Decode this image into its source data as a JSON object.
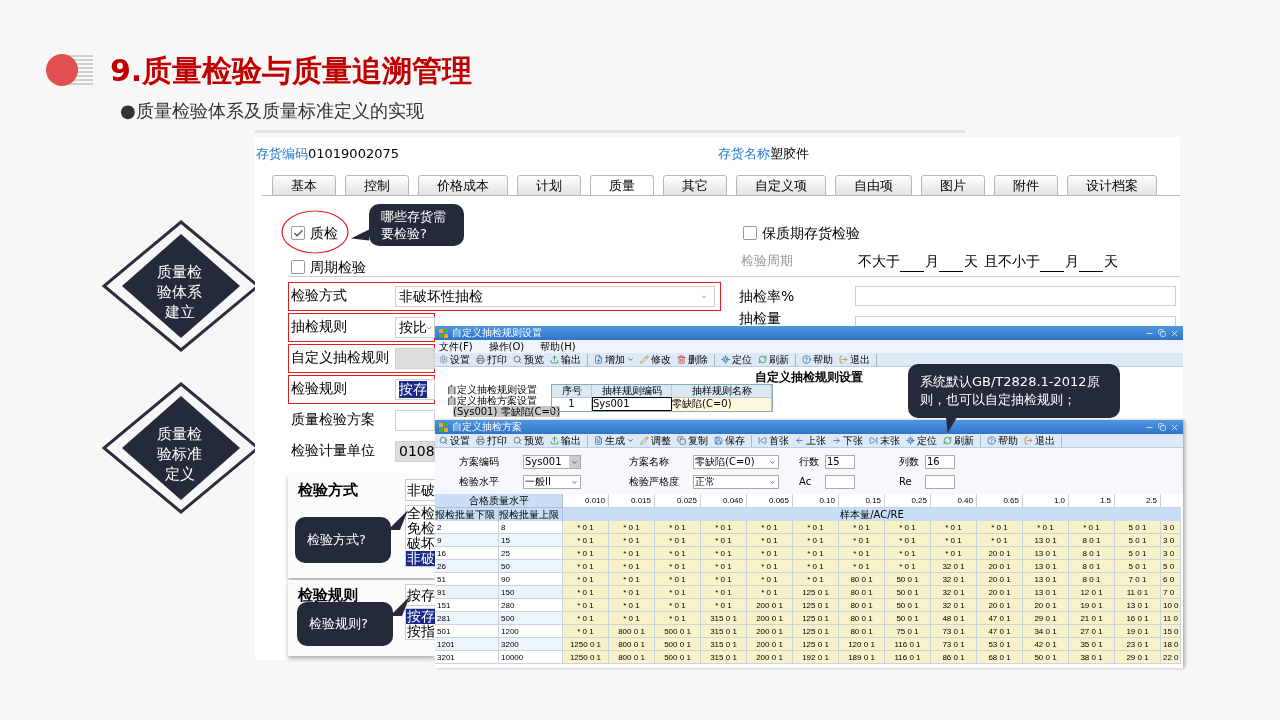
{
  "slide": {
    "title": "9.质量检验与质量追溯管理",
    "subtitle": "●质量检验体系及质量标准定义的实现"
  },
  "stages": [
    {
      "label": "质量检验体系建立"
    },
    {
      "label": "质量检验标准定义"
    }
  ],
  "inventory_form": {
    "code_label": "存货编码",
    "code": "01019002075",
    "name_label": "存货名称",
    "name": "塑胶件",
    "tabs": [
      {
        "label": "基本",
        "selected": false
      },
      {
        "label": "控制",
        "selected": false
      },
      {
        "label": "价格成本",
        "selected": false
      },
      {
        "label": "计划",
        "selected": false
      },
      {
        "label": "质量",
        "selected": true
      },
      {
        "label": "其它",
        "selected": false
      },
      {
        "label": "自定义项",
        "selected": false
      },
      {
        "label": "自由项",
        "selected": false
      },
      {
        "label": "图片",
        "selected": false
      },
      {
        "label": "附件",
        "selected": false
      },
      {
        "label": "设计档案",
        "selected": false
      }
    ],
    "checks": [
      {
        "label": "质检",
        "checked": true,
        "circled": true
      },
      {
        "label": "周期检验",
        "checked": false,
        "circled": false
      },
      {
        "label": "保质期存货检验",
        "checked": false,
        "circled": false
      }
    ],
    "period_label": "检验周期",
    "period_parts": [
      {
        "text": "不大于",
        "blank_before": false
      },
      {
        "text": "月",
        "blank_before": true
      },
      {
        "text": "天",
        "blank_before": true
      },
      {
        "text": "且不小于",
        "blank_before": false
      },
      {
        "text": "月",
        "blank_before": true
      },
      {
        "text": "天",
        "blank_before": true
      }
    ],
    "fields": [
      {
        "label": "检验方式",
        "value": "非破坏性抽检",
        "kind": "dropdown",
        "highlighted": true,
        "disabled": false
      },
      {
        "label": "抽检规则",
        "value": "按比",
        "kind": "dropdown",
        "highlighted": true,
        "disabled": false
      },
      {
        "label": "自定义抽检规则",
        "kind": "text",
        "highlighted": true,
        "disabled": true
      },
      {
        "label": "检验规则",
        "value": "按存",
        "kind": "text",
        "highlighted": true,
        "disabled": false,
        "value_selected": true
      },
      {
        "label": "质量检验方案",
        "kind": "text",
        "highlighted": false,
        "disabled": false
      },
      {
        "label": "检验计量单位",
        "value": "0108",
        "kind": "text",
        "highlighted": false,
        "disabled": true
      }
    ],
    "right_fields": [
      {
        "label": "抽检率%"
      },
      {
        "label": "抽检量"
      }
    ],
    "callout": "哪些存货需要检验?"
  },
  "popups": [
    {
      "label": "检验方式",
      "value": "非破",
      "options": [
        {
          "label": "全检",
          "selected": false
        },
        {
          "label": "免检",
          "selected": false
        },
        {
          "label": "破坏",
          "selected": false
        },
        {
          "label": "非破",
          "selected": true
        }
      ],
      "callout": "检验方式?"
    },
    {
      "label": "检验规则",
      "value": "按存",
      "options": [
        {
          "label": "按存",
          "selected": true
        },
        {
          "label": "按指",
          "selected": false
        }
      ],
      "callout": "检验规则?"
    }
  ],
  "rule_window": {
    "title": "自定义抽检规则设置",
    "menus": [
      "文件(F)",
      "操作(O)",
      "帮助(H)"
    ],
    "toolbar": [
      [
        {
          "label": "设置",
          "kind": "button"
        },
        {
          "label": "打印",
          "kind": "button"
        },
        {
          "label": "预览",
          "kind": "button"
        },
        {
          "label": "输出",
          "kind": "button"
        }
      ],
      [
        {
          "label": "增加",
          "kind": "dropdown"
        },
        {
          "label": "修改",
          "kind": "button"
        },
        {
          "label": "删除",
          "kind": "button"
        }
      ],
      [
        {
          "label": "定位",
          "kind": "button"
        },
        {
          "label": "刷新",
          "kind": "button"
        }
      ],
      [
        {
          "label": "帮助",
          "kind": "button"
        },
        {
          "label": "退出",
          "kind": "button"
        }
      ]
    ],
    "heading": "自定义抽检规则设置",
    "tree": [
      {
        "label": "自定义抽检规则设置",
        "selected": false
      },
      {
        "label": "自定义抽检方案设置",
        "selected": false,
        "children": [
          {
            "label": "(Sys001) 零缺陷(C=0)",
            "selected": true
          }
        ]
      }
    ],
    "table": {
      "columns": [
        "序号",
        "抽样规则编码",
        "抽样规则名称"
      ],
      "rows": [
        [
          "1",
          "Sys001",
          "零缺陷(C=0)"
        ]
      ]
    },
    "callout": "系统默认GB/T2828.1-2012原则，也可以自定抽检规则；"
  },
  "scheme_window": {
    "title": "自定义抽检方案",
    "toolbar": [
      [
        {
          "label": "设置",
          "kind": "button"
        },
        {
          "label": "打印",
          "kind": "button"
        },
        {
          "label": "预览",
          "kind": "button"
        },
        {
          "label": "输出",
          "kind": "button"
        }
      ],
      [
        {
          "label": "生成",
          "kind": "dropdown"
        },
        {
          "label": "调整",
          "kind": "button"
        },
        {
          "label": "复制",
          "kind": "button"
        },
        {
          "label": "保存",
          "kind": "button"
        }
      ],
      [
        {
          "label": "首张",
          "kind": "button"
        },
        {
          "label": "上张",
          "kind": "button"
        },
        {
          "label": "下张",
          "kind": "button"
        },
        {
          "label": "末张",
          "kind": "button"
        },
        {
          "label": "定位",
          "kind": "button"
        },
        {
          "label": "刷新",
          "kind": "button"
        }
      ],
      [
        {
          "label": "帮助",
          "kind": "button"
        },
        {
          "label": "退出",
          "kind": "button"
        }
      ]
    ],
    "form": [
      [
        {
          "label": "方案编码",
          "value": "Sys001",
          "kind": "combo"
        },
        {
          "label": "方案名称",
          "value": "零缺陷(C=0)",
          "kind": "dropdown"
        },
        {
          "label": "行数",
          "value": "15",
          "kind": "text"
        },
        {
          "label": "列数",
          "value": "16",
          "kind": "text"
        }
      ],
      [
        {
          "label": "检验水平",
          "value": "一般II",
          "kind": "dropdown"
        },
        {
          "label": "检验严格度",
          "value": "正常",
          "kind": "dropdown"
        },
        {
          "label": "Ac",
          "kind": "text"
        },
        {
          "label": "Re",
          "kind": "text"
        }
      ]
    ],
    "table": {
      "header_label": "合格质量水平",
      "aql": [
        "0.010",
        "0.015",
        "0.025",
        "0.040",
        "0.065",
        "0.10",
        "0.15",
        "0.25",
        "0.40",
        "0.65",
        "1.0",
        "1.5",
        "2.5"
      ],
      "lower_label": "报检批量下限",
      "upper_label": "报检批量上限",
      "span_label": "样本量/AC/RE",
      "rows": [
        {
          "lower": "2",
          "upper": "8",
          "cells": [
            "* 0 1",
            "* 0 1",
            "* 0 1",
            "* 0 1",
            "* 0 1",
            "* 0 1",
            "* 0 1",
            "* 0 1",
            "* 0 1",
            "* 0 1",
            "* 0 1",
            "* 0 1",
            "5 0 1",
            "3 0"
          ]
        },
        {
          "lower": "9",
          "upper": "15",
          "cells": [
            "* 0 1",
            "* 0 1",
            "* 0 1",
            "* 0 1",
            "* 0 1",
            "* 0 1",
            "* 0 1",
            "* 0 1",
            "* 0 1",
            "* 0 1",
            "13 0 1",
            "8 0 1",
            "5 0 1",
            "3 0"
          ]
        },
        {
          "lower": "16",
          "upper": "25",
          "cells": [
            "* 0 1",
            "* 0 1",
            "* 0 1",
            "* 0 1",
            "* 0 1",
            "* 0 1",
            "* 0 1",
            "* 0 1",
            "* 0 1",
            "20 0 1",
            "13 0 1",
            "8 0 1",
            "5 0 1",
            "3 0"
          ]
        },
        {
          "lower": "26",
          "upper": "50",
          "cells": [
            "* 0 1",
            "* 0 1",
            "* 0 1",
            "* 0 1",
            "* 0 1",
            "* 0 1",
            "* 0 1",
            "* 0 1",
            "32 0 1",
            "20 0 1",
            "13 0 1",
            "8 0 1",
            "5 0 1",
            "5 0"
          ]
        },
        {
          "lower": "51",
          "upper": "90",
          "cells": [
            "* 0 1",
            "* 0 1",
            "* 0 1",
            "* 0 1",
            "* 0 1",
            "* 0 1",
            "80 0 1",
            "50 0 1",
            "32 0 1",
            "20 0 1",
            "13 0 1",
            "8 0 1",
            "7 0 1",
            "6 0"
          ]
        },
        {
          "lower": "91",
          "upper": "150",
          "cells": [
            "* 0 1",
            "* 0 1",
            "* 0 1",
            "* 0 1",
            "* 0 1",
            "125 0 1",
            "80 0 1",
            "50 0 1",
            "32 0 1",
            "20 0 1",
            "13 0 1",
            "12 0 1",
            "11 0 1",
            "7 0"
          ]
        },
        {
          "lower": "151",
          "upper": "280",
          "cells": [
            "* 0 1",
            "* 0 1",
            "* 0 1",
            "* 0 1",
            "200 0 1",
            "125 0 1",
            "80 0 1",
            "50 0 1",
            "32 0 1",
            "20 0 1",
            "20 0 1",
            "19 0 1",
            "13 0 1",
            "10 0"
          ]
        },
        {
          "lower": "281",
          "upper": "500",
          "cells": [
            "* 0 1",
            "* 0 1",
            "* 0 1",
            "315 0 1",
            "200 0 1",
            "125 0 1",
            "80 0 1",
            "50 0 1",
            "48 0 1",
            "47 0 1",
            "29 0 1",
            "21 0 1",
            "16 0 1",
            "11 0"
          ]
        },
        {
          "lower": "501",
          "upper": "1200",
          "cells": [
            "* 0 1",
            "800 0 1",
            "500 0 1",
            "315 0 1",
            "200 0 1",
            "125 0 1",
            "80 0 1",
            "75 0 1",
            "73 0 1",
            "47 0 1",
            "34 0 1",
            "27 0 1",
            "19 0 1",
            "15 0"
          ]
        },
        {
          "lower": "1201",
          "upper": "3200",
          "cells": [
            "1250 0 1",
            "800 0 1",
            "500 0 1",
            "315 0 1",
            "200 0 1",
            "125 0 1",
            "120 0 1",
            "116 0 1",
            "73 0 1",
            "53 0 1",
            "42 0 1",
            "35 0 1",
            "23 0 1",
            "18 0"
          ]
        },
        {
          "lower": "3201",
          "upper": "10000",
          "cells": [
            "1250 0 1",
            "800 0 1",
            "500 0 1",
            "315 0 1",
            "200 0 1",
            "192 0 1",
            "189 0 1",
            "116 0 1",
            "86 0 1",
            "68 0 1",
            "50 0 1",
            "38 0 1",
            "29 0 1",
            "22 0"
          ]
        }
      ]
    }
  }
}
